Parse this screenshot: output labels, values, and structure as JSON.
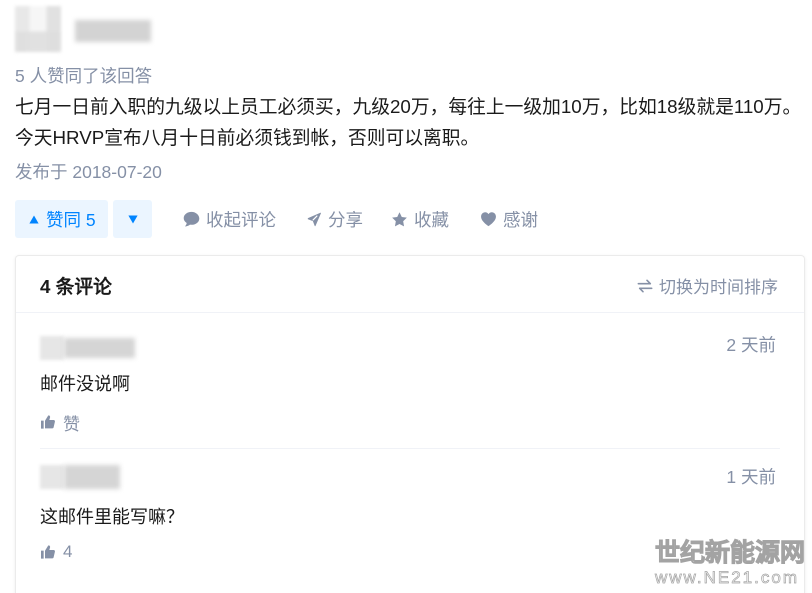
{
  "answer": {
    "upvote_summary": "5 人赞同了该回答",
    "content": "七月一日前入职的九级以上员工必须买，九级20万，每往上一级加10万，比如18级就是110万。今天HRVP宣布八月十日前必须钱到帐，否则可以离职。",
    "published": "发布于 2018-07-20"
  },
  "actions": {
    "upvote": {
      "label": "赞同 5",
      "icon": "triangle-up-icon"
    },
    "downvote": {
      "icon": "triangle-down-icon"
    },
    "collapse_comments": {
      "label": "收起评论",
      "icon": "comment-icon"
    },
    "share": {
      "label": "分享",
      "icon": "paper-plane-icon"
    },
    "favorite": {
      "label": "收藏",
      "icon": "star-icon"
    },
    "thanks": {
      "label": "感谢",
      "icon": "heart-icon"
    }
  },
  "comments": {
    "count_label": "4 条评论",
    "sort_toggle": {
      "label": "切换为时间排序",
      "icon": "swap-arrows-icon"
    },
    "items": [
      {
        "time": "2 天前",
        "text": "邮件没说啊",
        "like": {
          "label": "赞",
          "icon": "thumbs-up-icon"
        }
      },
      {
        "time": "1 天前",
        "text": "这邮件里能写嘛？",
        "like": {
          "label": "4",
          "icon": "thumbs-up-icon"
        }
      }
    ]
  },
  "watermark": {
    "name": "世纪新能源网",
    "url": "www.NE21.com"
  },
  "colors": {
    "accent": "#0084ff",
    "upvote_bg": "#ebf5ff",
    "meta_text": "#8590a6",
    "body_text": "#1a1a1a",
    "border": "#ebebeb"
  }
}
